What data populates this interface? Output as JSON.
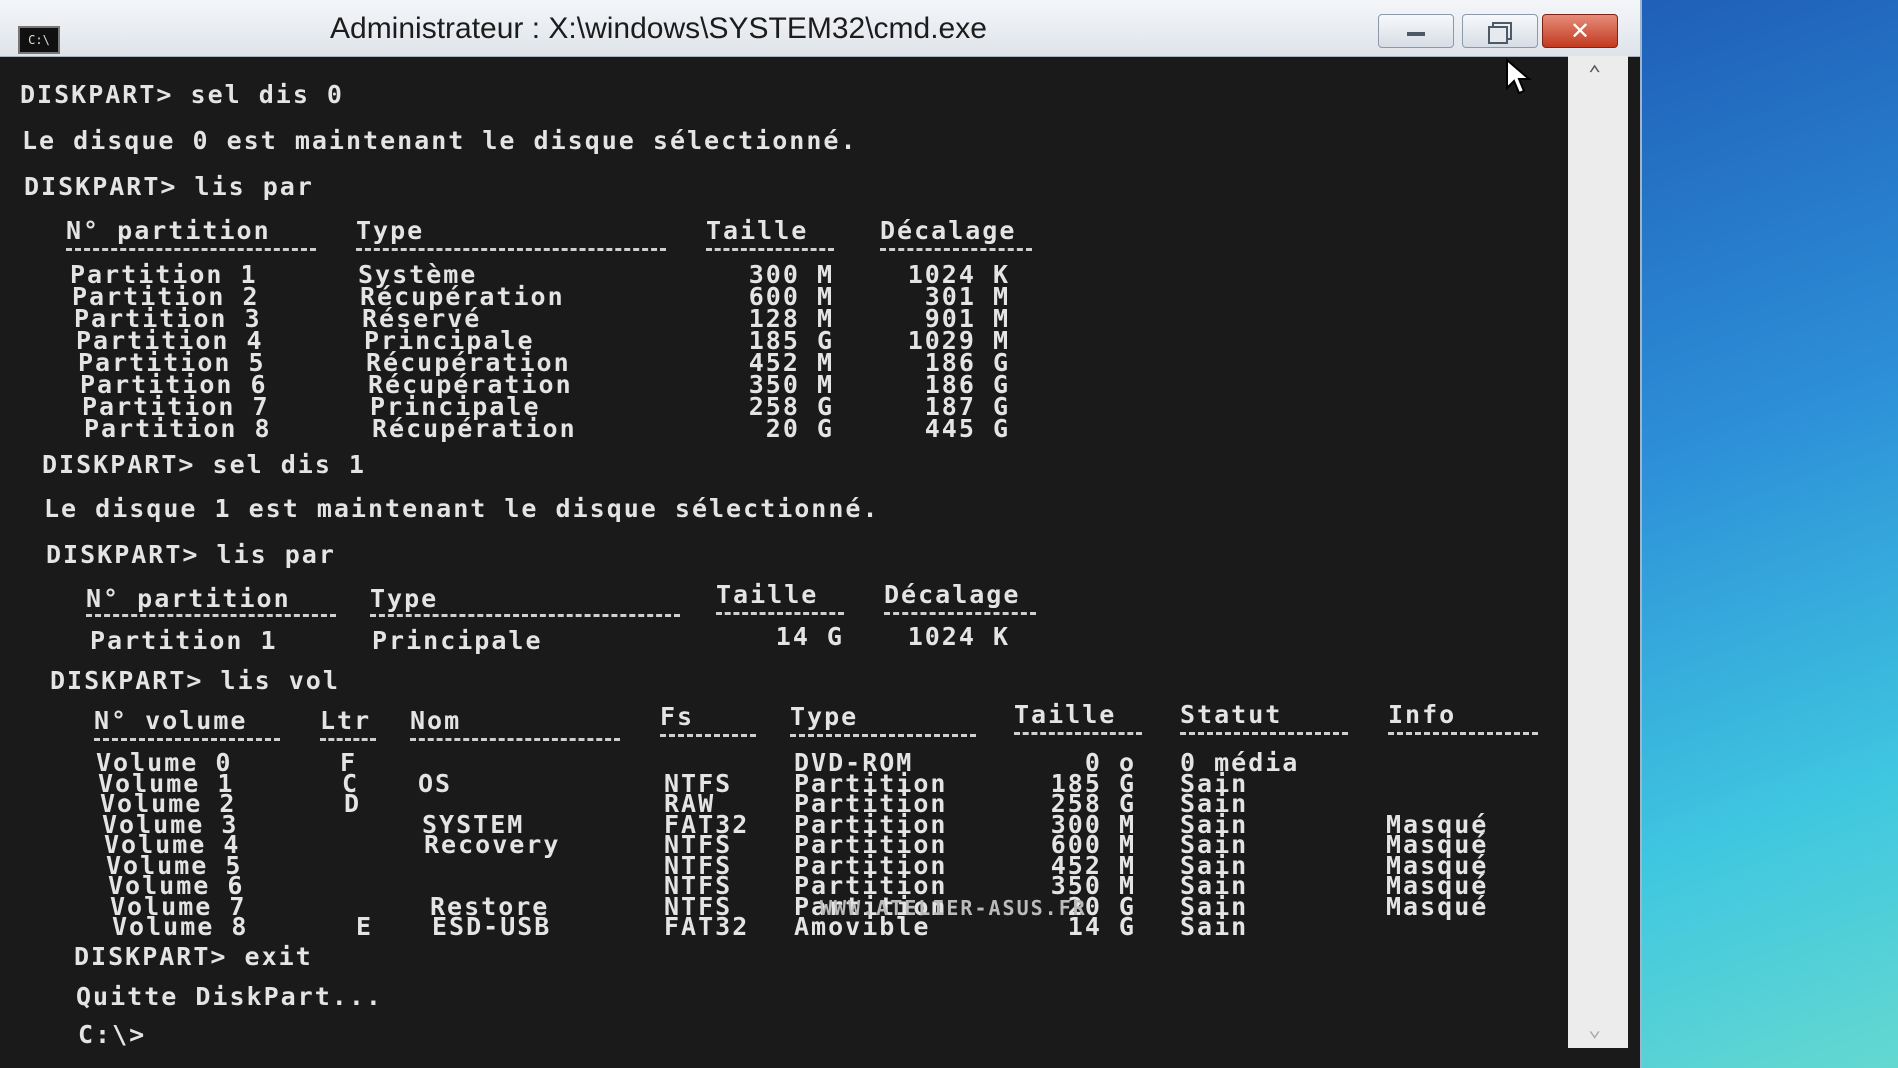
{
  "window": {
    "icon_text": "C:\\",
    "title": "Administrateur : X:\\windows\\SYSTEM32\\cmd.exe"
  },
  "console": {
    "cmd1": "DISKPART> sel dis 0",
    "msg1": "Le disque 0 est maintenant le disque sélectionné.",
    "cmd2": "DISKPART> lis par",
    "part_headers": [
      "N° partition",
      "Type",
      "Taille",
      "Décalage"
    ],
    "partitions_disk0": [
      {
        "name": "Partition 1",
        "type": "Système",
        "size": "300 M",
        "offset": "1024 K"
      },
      {
        "name": "Partition 2",
        "type": "Récupération",
        "size": "600 M",
        "offset": "301 M"
      },
      {
        "name": "Partition 3",
        "type": "Réservé",
        "size": "128 M",
        "offset": "901 M"
      },
      {
        "name": "Partition 4",
        "type": "Principale",
        "size": "185 G",
        "offset": "1029 M"
      },
      {
        "name": "Partition 5",
        "type": "Récupération",
        "size": "452 M",
        "offset": "186 G"
      },
      {
        "name": "Partition 6",
        "type": "Récupération",
        "size": "350 M",
        "offset": "186 G"
      },
      {
        "name": "Partition 7",
        "type": "Principale",
        "size": "258 G",
        "offset": "187 G"
      },
      {
        "name": "Partition 8",
        "type": "Récupération",
        "size": "20 G",
        "offset": "445 G"
      }
    ],
    "cmd3": "DISKPART> sel dis 1",
    "msg2": "Le disque 1 est maintenant le disque sélectionné.",
    "cmd4": "DISKPART> lis par",
    "partitions_disk1": [
      {
        "name": "Partition 1",
        "type": "Principale",
        "size": "14 G",
        "offset": "1024 K"
      }
    ],
    "cmd5": "DISKPART> lis vol",
    "vol_headers": [
      "N° volume",
      "Ltr",
      "Nom",
      "Fs",
      "Type",
      "Taille",
      "Statut",
      "Info"
    ],
    "volumes": [
      {
        "vol": "Volume 0",
        "ltr": "F",
        "nom": "",
        "fs": "",
        "type": "DVD-ROM",
        "size": "0 o",
        "status": "0 média",
        "info": ""
      },
      {
        "vol": "Volume 1",
        "ltr": "C",
        "nom": "OS",
        "fs": "NTFS",
        "type": "Partition",
        "size": "185 G",
        "status": "Sain",
        "info": ""
      },
      {
        "vol": "Volume 2",
        "ltr": "D",
        "nom": "",
        "fs": "RAW",
        "type": "Partition",
        "size": "258 G",
        "status": "Sain",
        "info": ""
      },
      {
        "vol": "Volume 3",
        "ltr": "",
        "nom": "SYSTEM",
        "fs": "FAT32",
        "type": "Partition",
        "size": "300 M",
        "status": "Sain",
        "info": "Masqué"
      },
      {
        "vol": "Volume 4",
        "ltr": "",
        "nom": "Recovery",
        "fs": "NTFS",
        "type": "Partition",
        "size": "600 M",
        "status": "Sain",
        "info": "Masqué"
      },
      {
        "vol": "Volume 5",
        "ltr": "",
        "nom": "",
        "fs": "NTFS",
        "type": "Partition",
        "size": "452 M",
        "status": "Sain",
        "info": "Masqué"
      },
      {
        "vol": "Volume 6",
        "ltr": "",
        "nom": "",
        "fs": "NTFS",
        "type": "Partition",
        "size": "350 M",
        "status": "Sain",
        "info": "Masqué"
      },
      {
        "vol": "Volume 7",
        "ltr": "",
        "nom": "Restore",
        "fs": "NTFS",
        "type": "Partition",
        "size": "20 G",
        "status": "Sain",
        "info": "Masqué"
      },
      {
        "vol": "Volume 8",
        "ltr": "E",
        "nom": "ESD-USB",
        "fs": "FAT32",
        "type": "Amovible",
        "size": "14 G",
        "status": "Sain",
        "info": ""
      }
    ],
    "cmd6": "DISKPART> exit",
    "msg3": "Quitte DiskPart...",
    "prompt": "C:\\>"
  },
  "watermark": "WWW.ATELIER-ASUS.FR",
  "colors": {
    "console_bg": "#1a1a1a",
    "console_text": "#e4e4e4",
    "close_button": "#c33a1f"
  }
}
